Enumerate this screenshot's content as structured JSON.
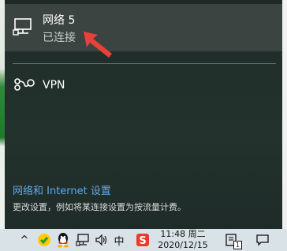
{
  "network_flyout": {
    "network": {
      "name": "网络 5",
      "status": "已连接"
    },
    "vpn": {
      "label": "VPN"
    },
    "settings": {
      "link": "网络和 Internet 设置",
      "description": "更改设置，例如将某连接设置为按流量计费。"
    }
  },
  "taskbar": {
    "tray": {
      "show_hidden_icon": "^",
      "ime_indicator": "中"
    },
    "clock": {
      "time": "11:48 周二",
      "date": "2020/12/15"
    },
    "notification_count": "1"
  },
  "colors": {
    "flyout_bg": "#22302c",
    "selected_item_bg": "#3b4441",
    "link": "#5fa9ea",
    "annotation_arrow": "#e8403a",
    "taskbar_bg": "#d9e2e6"
  }
}
